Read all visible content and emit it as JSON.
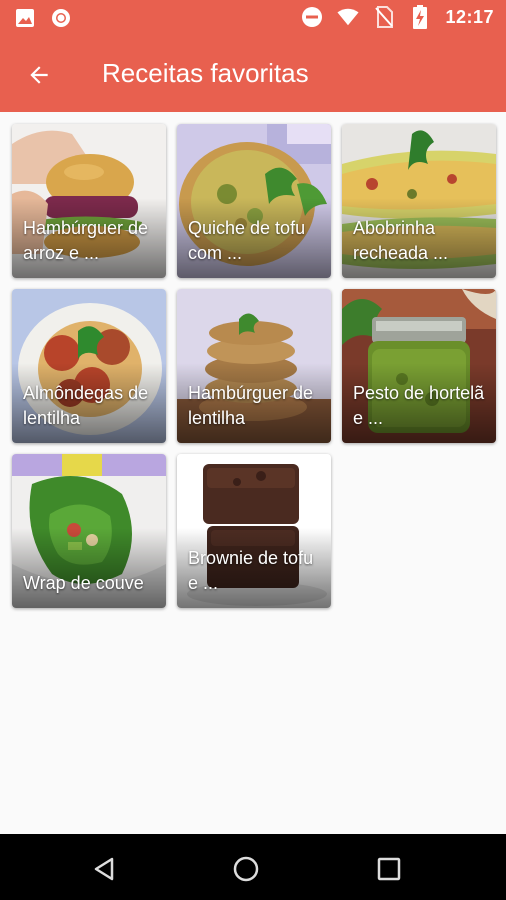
{
  "status_bar": {
    "time": "12:17",
    "left_icons": [
      "image-icon",
      "record-icon"
    ],
    "right_icons": [
      "do-not-disturb-icon",
      "wifi-icon",
      "no-sim-icon",
      "battery-charging-icon"
    ]
  },
  "app_bar": {
    "title": "Receitas favoritas",
    "back_icon": "arrow-back-icon",
    "color": "#e8604f"
  },
  "recipes": [
    {
      "label": "Hambúrguer de arroz e ..."
    },
    {
      "label": "Quiche de tofu com ..."
    },
    {
      "label": "Abobrinha recheada ..."
    },
    {
      "label": "Almôndegas de lentilha"
    },
    {
      "label": "Hambúrguer de lentilha"
    },
    {
      "label": "Pesto de hortelã e ..."
    },
    {
      "label": "Wrap de couve"
    },
    {
      "label": "Brownie de tofu e ..."
    }
  ],
  "nav_bar": {
    "icons": [
      "back-triangle-icon",
      "home-circle-icon",
      "recents-square-icon"
    ]
  }
}
